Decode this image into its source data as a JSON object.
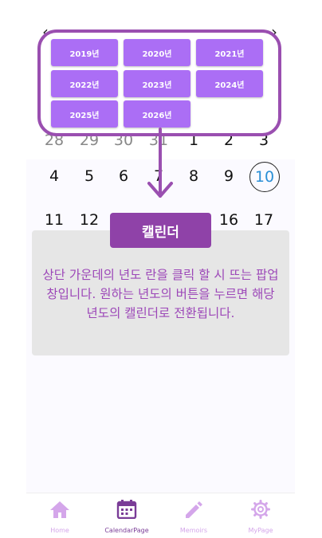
{
  "calendar": {
    "row1": [
      "28",
      "29",
      "30",
      "31",
      "1",
      "2",
      "3"
    ],
    "row2": [
      "4",
      "5",
      "6",
      "7",
      "8",
      "9",
      "10"
    ],
    "row3": [
      "11",
      "12",
      "16",
      "17"
    ]
  },
  "year_popup": {
    "years": [
      "2019년",
      "2020년",
      "2021년",
      "2022년",
      "2023년",
      "2024년",
      "2025년",
      "2026년"
    ]
  },
  "overlay": {
    "title": "캘린더",
    "description": "상단 가운데의 년도 란을 클릭 할 시 뜨는 팝업 창입니다. 원하는 년도의 버튼을 누르면 해당 년도의 캘린더로 전환됩니다."
  },
  "bottom_nav": {
    "items": [
      {
        "label": "Home",
        "icon": "home-icon"
      },
      {
        "label": "CalendarPage",
        "icon": "calendar-icon"
      },
      {
        "label": "Memoirs",
        "icon": "pencil-icon"
      },
      {
        "label": "MyPage",
        "icon": "gear-icon"
      }
    ]
  },
  "colors": {
    "accent": "#ab6ef5",
    "overlay_title_bg": "#8f42a8",
    "popup_border": "#9a4fb0",
    "today": "#2a8fd6",
    "nav_inactive": "#d4a6ea"
  }
}
